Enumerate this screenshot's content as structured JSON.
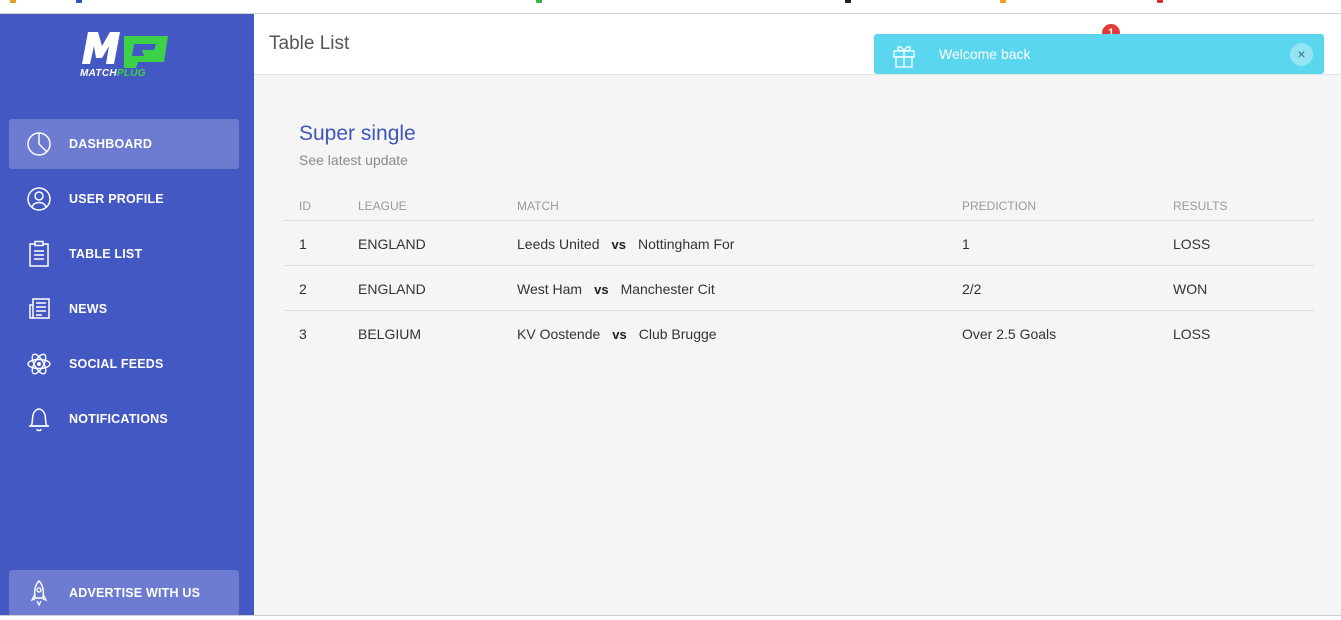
{
  "brand": {
    "logo_text_a": "MATCH",
    "logo_text_b": "PLUG"
  },
  "sidebar": {
    "items": [
      {
        "label": "DASHBOARD",
        "icon": "pie-chart-icon",
        "active": true
      },
      {
        "label": "USER PROFILE",
        "icon": "user-icon",
        "active": false
      },
      {
        "label": "TABLE LIST",
        "icon": "clipboard-icon",
        "active": false
      },
      {
        "label": "NEWS",
        "icon": "newspaper-icon",
        "active": false
      },
      {
        "label": "SOCIAL FEEDS",
        "icon": "atom-icon",
        "active": false
      },
      {
        "label": "NOTIFICATIONS",
        "icon": "bell-icon",
        "active": false
      }
    ],
    "advertise": {
      "label": "ADVERTISE WITH US",
      "icon": "rocket-icon"
    }
  },
  "header": {
    "title": "Table List",
    "notification_count": "1"
  },
  "toast": {
    "message": "Welcome back",
    "close": "×",
    "icon": "gift-icon"
  },
  "card": {
    "title": "Super single",
    "subtitle": "See latest update",
    "columns": [
      "ID",
      "LEAGUE",
      "MATCH",
      "PREDICTION",
      "RESULTS"
    ],
    "rows": [
      {
        "id": "1",
        "league": "ENGLAND",
        "home": "Leeds United",
        "vs": "vs",
        "away": "Nottingham For",
        "prediction": "1",
        "result": "LOSS"
      },
      {
        "id": "2",
        "league": "ENGLAND",
        "home": "West Ham",
        "vs": "vs",
        "away": "Manchester Cit",
        "prediction": "2/2",
        "result": "WON"
      },
      {
        "id": "3",
        "league": "BELGIUM",
        "home": "KV Oostende",
        "vs": "vs",
        "away": "Club Brugge",
        "prediction": "Over 2.5 Goals",
        "result": "LOSS"
      }
    ]
  },
  "colors": {
    "sidebar": "#4458c3",
    "accent": "#3e56b9",
    "toast": "#5bd6ef",
    "badge": "#e23a3a",
    "logo_green": "#3dd14a"
  }
}
